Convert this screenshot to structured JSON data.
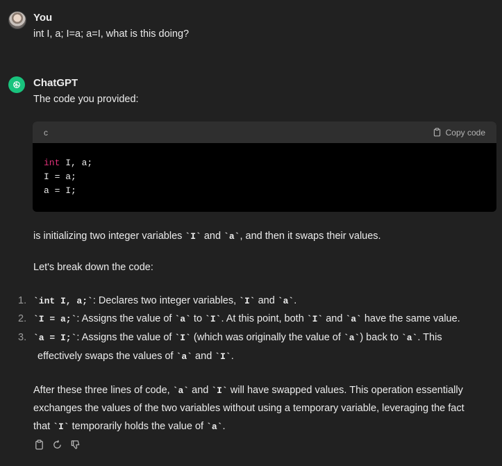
{
  "user": {
    "author": "You",
    "message": "int I, a; I=a; a=I, what is this doing?"
  },
  "assistant": {
    "author": "ChatGPT",
    "intro": "The code you provided:",
    "code_lang": "c",
    "copy_label": "Copy code",
    "code_kw": "int",
    "code_line1_rest": " I, a;",
    "code_line2": "I = a;",
    "code_line3": "a = I;",
    "summary": {
      "t1": "is initializing two integer variables ",
      "c1": "`I`",
      "t2": " and ",
      "c2": "`a`",
      "t3": ", and then it swaps their values."
    },
    "breakdown_intro": "Let's break down the code:",
    "items": [
      {
        "num": "1.",
        "code": "`int I, a;`",
        "t1": ": Declares two integer variables, ",
        "c1": "`I`",
        "t2": " and ",
        "c2": "`a`",
        "t3": "."
      },
      {
        "num": "2.",
        "code": "`I = a;`",
        "t1": ": Assigns the value of ",
        "c1": "`a`",
        "t2": " to ",
        "c2": "`I`",
        "t3": ". At this point, both ",
        "c3": "`I`",
        "t4": " and ",
        "c4": "`a`",
        "t5": " have the same value."
      },
      {
        "num": "3.",
        "code": "`a = I;`",
        "t1": ": Assigns the value of ",
        "c1": "`I`",
        "t2": " (which was originally the value of ",
        "c2": "`a`",
        "t3": ") back to ",
        "c3": "`a`",
        "t4": ". This",
        "l2_t1": "effectively swaps the values of ",
        "l2_c1": "`a`",
        "l2_t2": " and ",
        "l2_c2": "`I`",
        "l2_t3": "."
      }
    ],
    "conclusion": {
      "l1_t1": "After these three lines of code, ",
      "l1_c1": "`a`",
      "l1_t2": " and ",
      "l1_c2": "`I`",
      "l1_t3": " will have swapped values. This operation essentially",
      "l2": "exchanges the values of the two variables without using a temporary variable, leveraging the fact",
      "l3_t1": "that ",
      "l3_c1": "`I`",
      "l3_t2": " temporarily holds the value of ",
      "l3_c2": "`a`",
      "l3_t3": "."
    }
  },
  "icons": [
    "clipboard-icon",
    "regenerate-icon",
    "thumbs-down-icon"
  ],
  "colors": {
    "background": "#212121",
    "code_bg": "#000000",
    "code_header": "#2f2f2f",
    "keyword": "#df3079",
    "gpt_green": "#19c37d"
  }
}
